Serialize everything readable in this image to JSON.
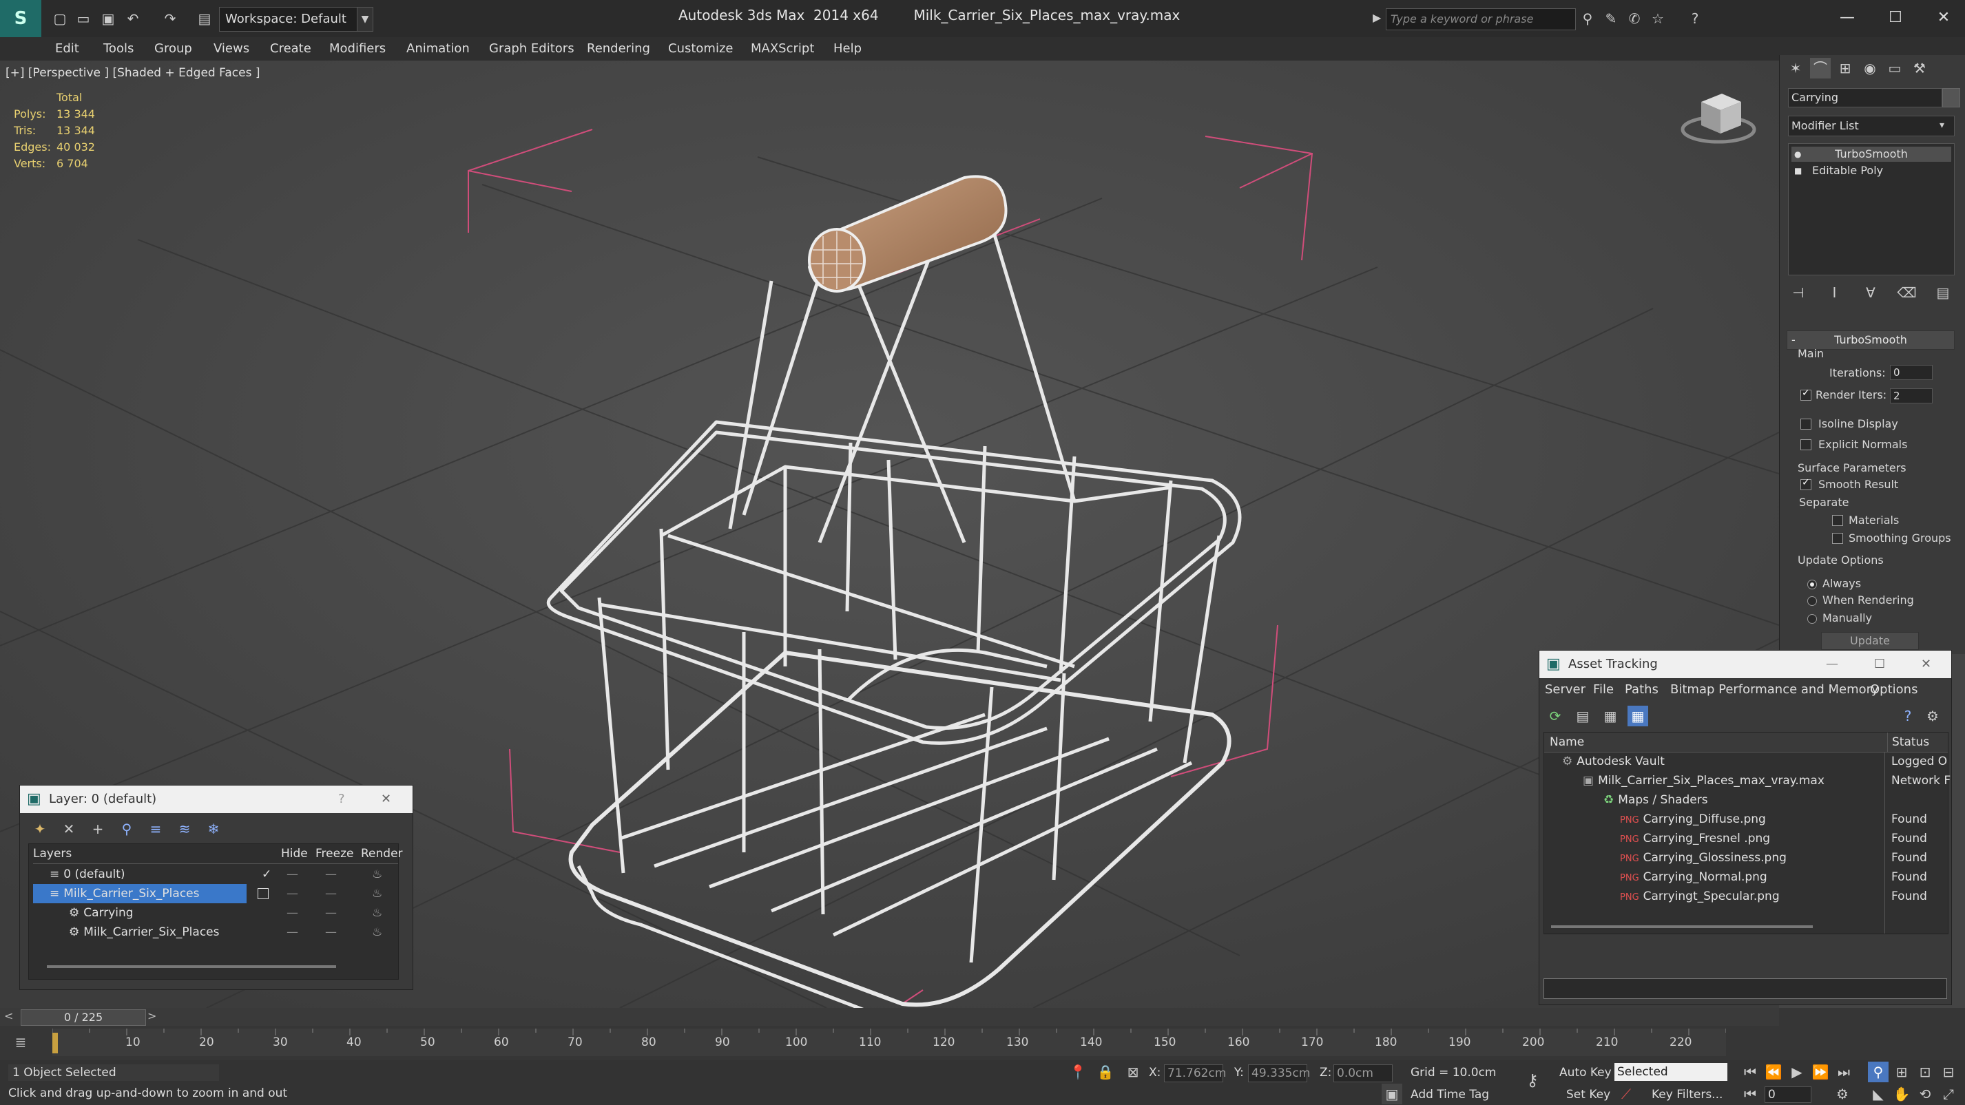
{
  "app": {
    "title": "Autodesk 3ds Max  2014 x64",
    "file": "Milk_Carrier_Six_Places_max_vray.max",
    "workspace": "Workspace: Default",
    "search_placeholder": "Type a keyword or phrase"
  },
  "menu": [
    "Edit",
    "Tools",
    "Group",
    "Views",
    "Create",
    "Modifiers",
    "Animation",
    "Graph Editors",
    "Rendering",
    "Customize",
    "MAXScript",
    "Help"
  ],
  "viewport": {
    "label": "[+] [Perspective ] [Shaded + Edged Faces ]",
    "stats_header": "Total",
    "stats": [
      {
        "k": "Polys:",
        "v": "13 344"
      },
      {
        "k": "Tris:",
        "v": "13 344"
      },
      {
        "k": "Edges:",
        "v": "40 032"
      },
      {
        "k": "Verts:",
        "v": "6 704"
      }
    ]
  },
  "command_panel": {
    "object_name": "Carrying",
    "modifier_list": "Modifier List",
    "stack": [
      "TurboSmooth",
      "Editable Poly"
    ],
    "rollout": "TurboSmooth",
    "main_label": "Main",
    "iterations_label": "Iterations:",
    "iterations_value": "0",
    "render_iters_label": "Render Iters:",
    "render_iters_value": "2",
    "isoline": "Isoline Display",
    "explicit": "Explicit Normals",
    "surface_label": "Surface Parameters",
    "smooth_result": "Smooth Result",
    "separate": "Separate",
    "materials": "Materials",
    "smoothing_groups": "Smoothing Groups",
    "update_options": "Update Options",
    "always": "Always",
    "when_rendering": "When Rendering",
    "manually": "Manually",
    "update": "Update"
  },
  "layer_dialog": {
    "title": "Layer: 0 (default)",
    "help": "?",
    "columns": {
      "layers": "Layers",
      "hide": "Hide",
      "freeze": "Freeze",
      "render": "Render"
    },
    "rows": [
      {
        "name": "0 (default)",
        "indent": 1
      },
      {
        "name": "Milk_Carrier_Six_Places",
        "indent": 1
      },
      {
        "name": "Carrying",
        "indent": 2
      },
      {
        "name": "Milk_Carrier_Six_Places",
        "indent": 2
      }
    ]
  },
  "asset_dialog": {
    "title": "Asset Tracking",
    "menu": [
      "Server",
      "File",
      "Paths",
      "Bitmap Performance and Memory",
      "Options"
    ],
    "col_name": "Name",
    "col_status": "Status",
    "rows": [
      {
        "name": "Autodesk Vault",
        "status": "Logged O"
      },
      {
        "name": "Milk_Carrier_Six_Places_max_vray.max",
        "status": "Network F"
      },
      {
        "name": "Maps / Shaders",
        "status": ""
      },
      {
        "name": "Carrying_Diffuse.png",
        "status": "Found"
      },
      {
        "name": "Carrying_Fresnel .png",
        "status": "Found"
      },
      {
        "name": "Carrying_Glossiness.png",
        "status": "Found"
      },
      {
        "name": "Carrying_Normal.png",
        "status": "Found"
      },
      {
        "name": "Carryingt_Specular.png",
        "status": "Found"
      }
    ]
  },
  "timeline": {
    "frame": "0 / 225",
    "ticks": [
      "10",
      "20",
      "30",
      "40",
      "50",
      "60",
      "70",
      "80",
      "90",
      "100",
      "110",
      "120",
      "130",
      "140",
      "150",
      "160",
      "170",
      "180",
      "190",
      "200",
      "210",
      "220"
    ]
  },
  "statusbar": {
    "selected": "1 Object Selected",
    "prompt": "Click and drag up-and-down to zoom in and out",
    "x_label": "X:",
    "x_value": "71.762cm",
    "y_label": "Y:",
    "y_value": "49.335cm",
    "z_label": "Z:",
    "z_value": "0.0cm",
    "grid": "Grid = 10.0cm",
    "add_time_tag": "Add Time Tag",
    "auto_key": "Auto Key",
    "auto_key_sel": "Selected",
    "set_key": "Set Key",
    "key_filters": "Key Filters...",
    "frame_field": "0"
  }
}
